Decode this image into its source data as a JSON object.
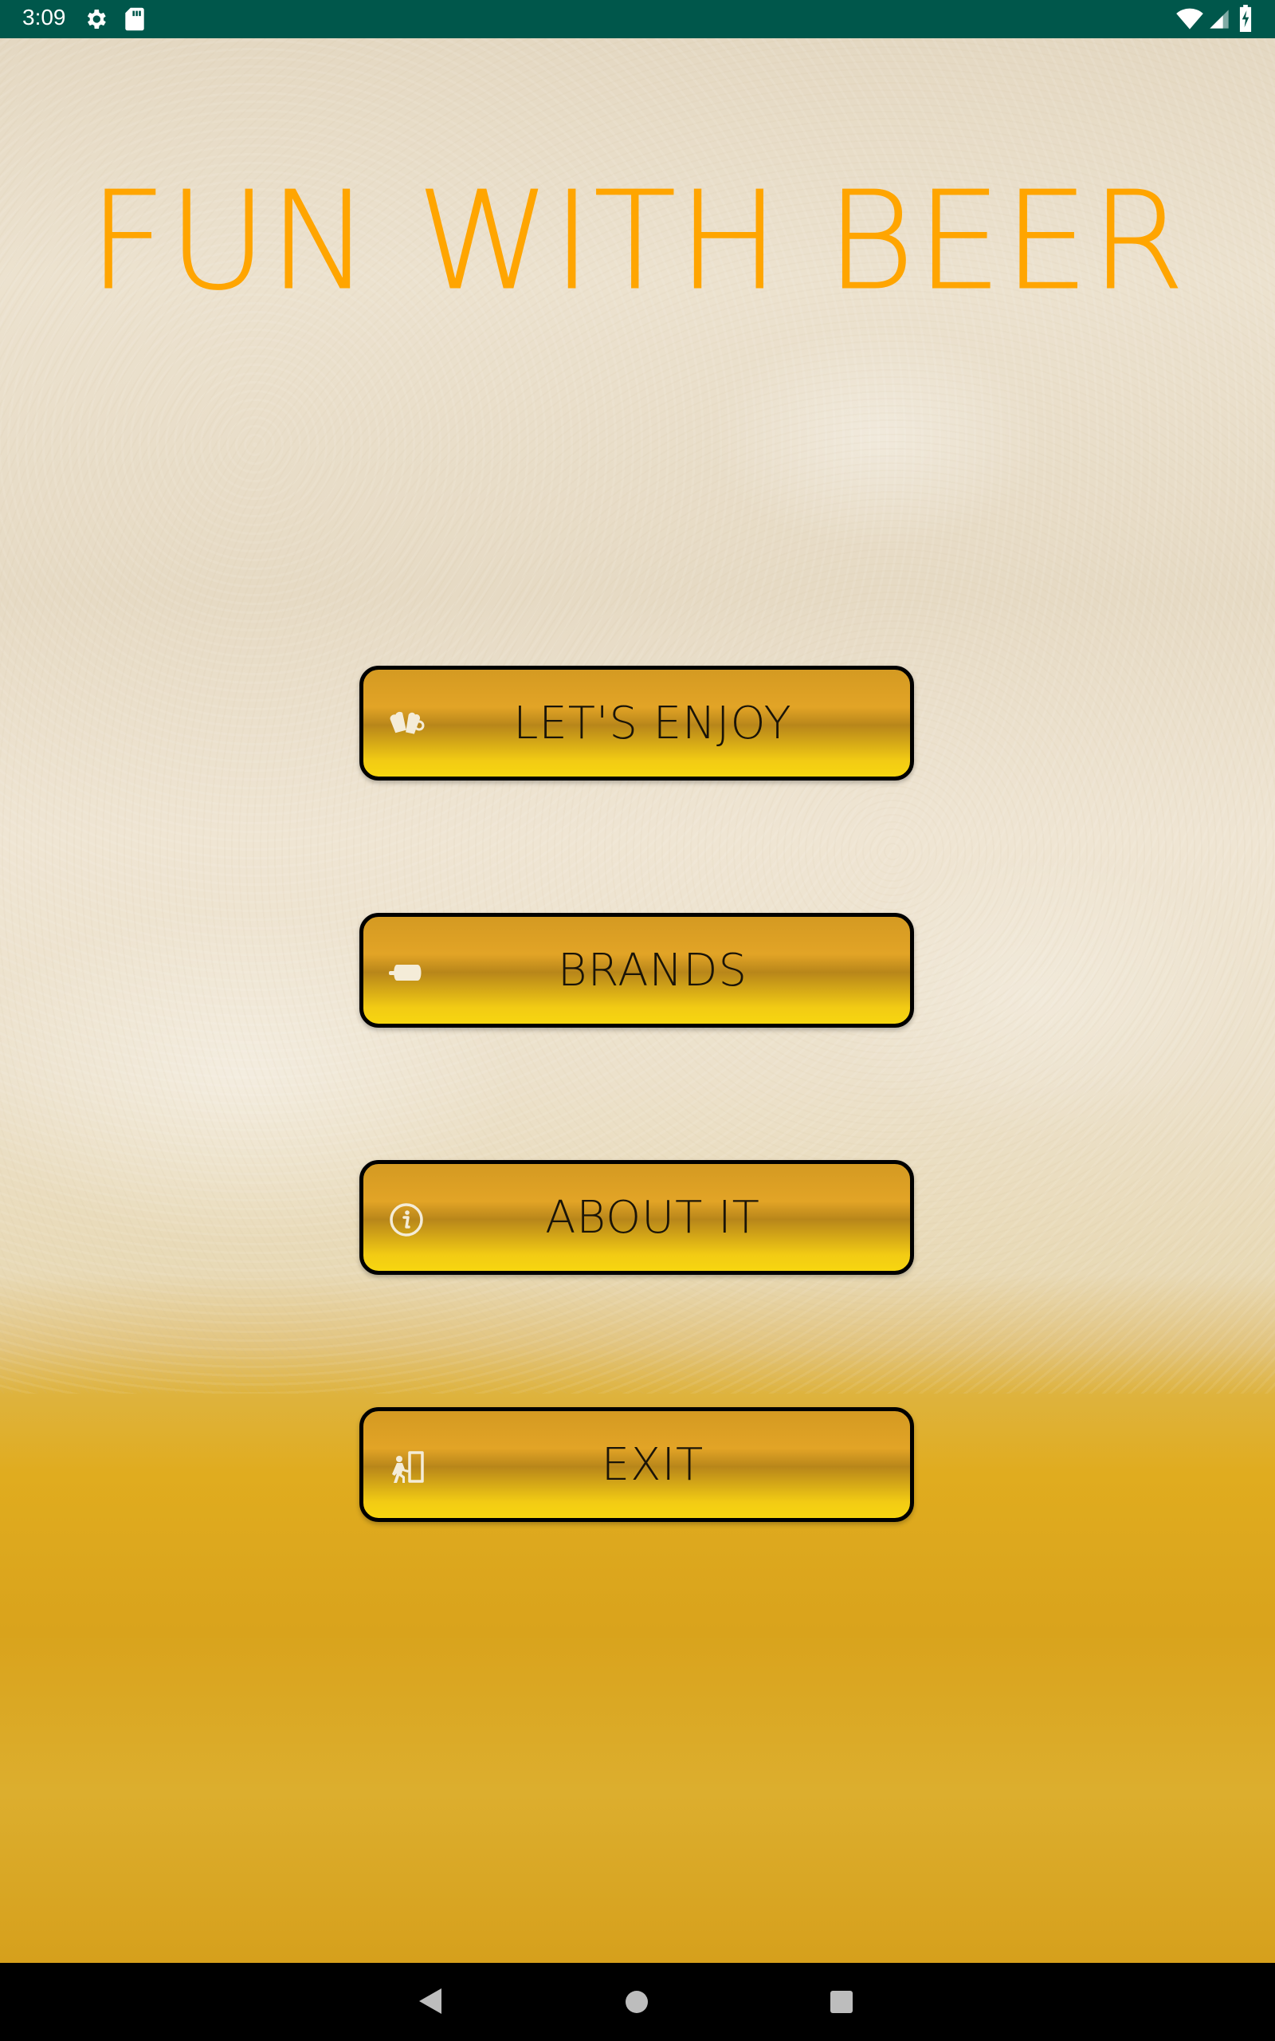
{
  "status_bar": {
    "time": "3:09",
    "icons": [
      "settings-icon",
      "sd-card-icon",
      "wifi-icon",
      "cell-signal-icon",
      "battery-charging-icon"
    ],
    "background_color": "#00574b"
  },
  "main": {
    "title": "FUN WITH BEER",
    "title_color": "#ffa500",
    "buttons": [
      {
        "label": "LET'S ENJOY",
        "icon": "beer-mugs-icon"
      },
      {
        "label": "BRANDS",
        "icon": "beer-barrel-icon"
      },
      {
        "label": "ABOUT IT",
        "icon": "info-icon"
      },
      {
        "label": "EXIT",
        "icon": "exit-door-icon"
      }
    ]
  },
  "nav_bar": {
    "icons": [
      "back-icon",
      "home-icon",
      "recents-icon"
    ]
  }
}
